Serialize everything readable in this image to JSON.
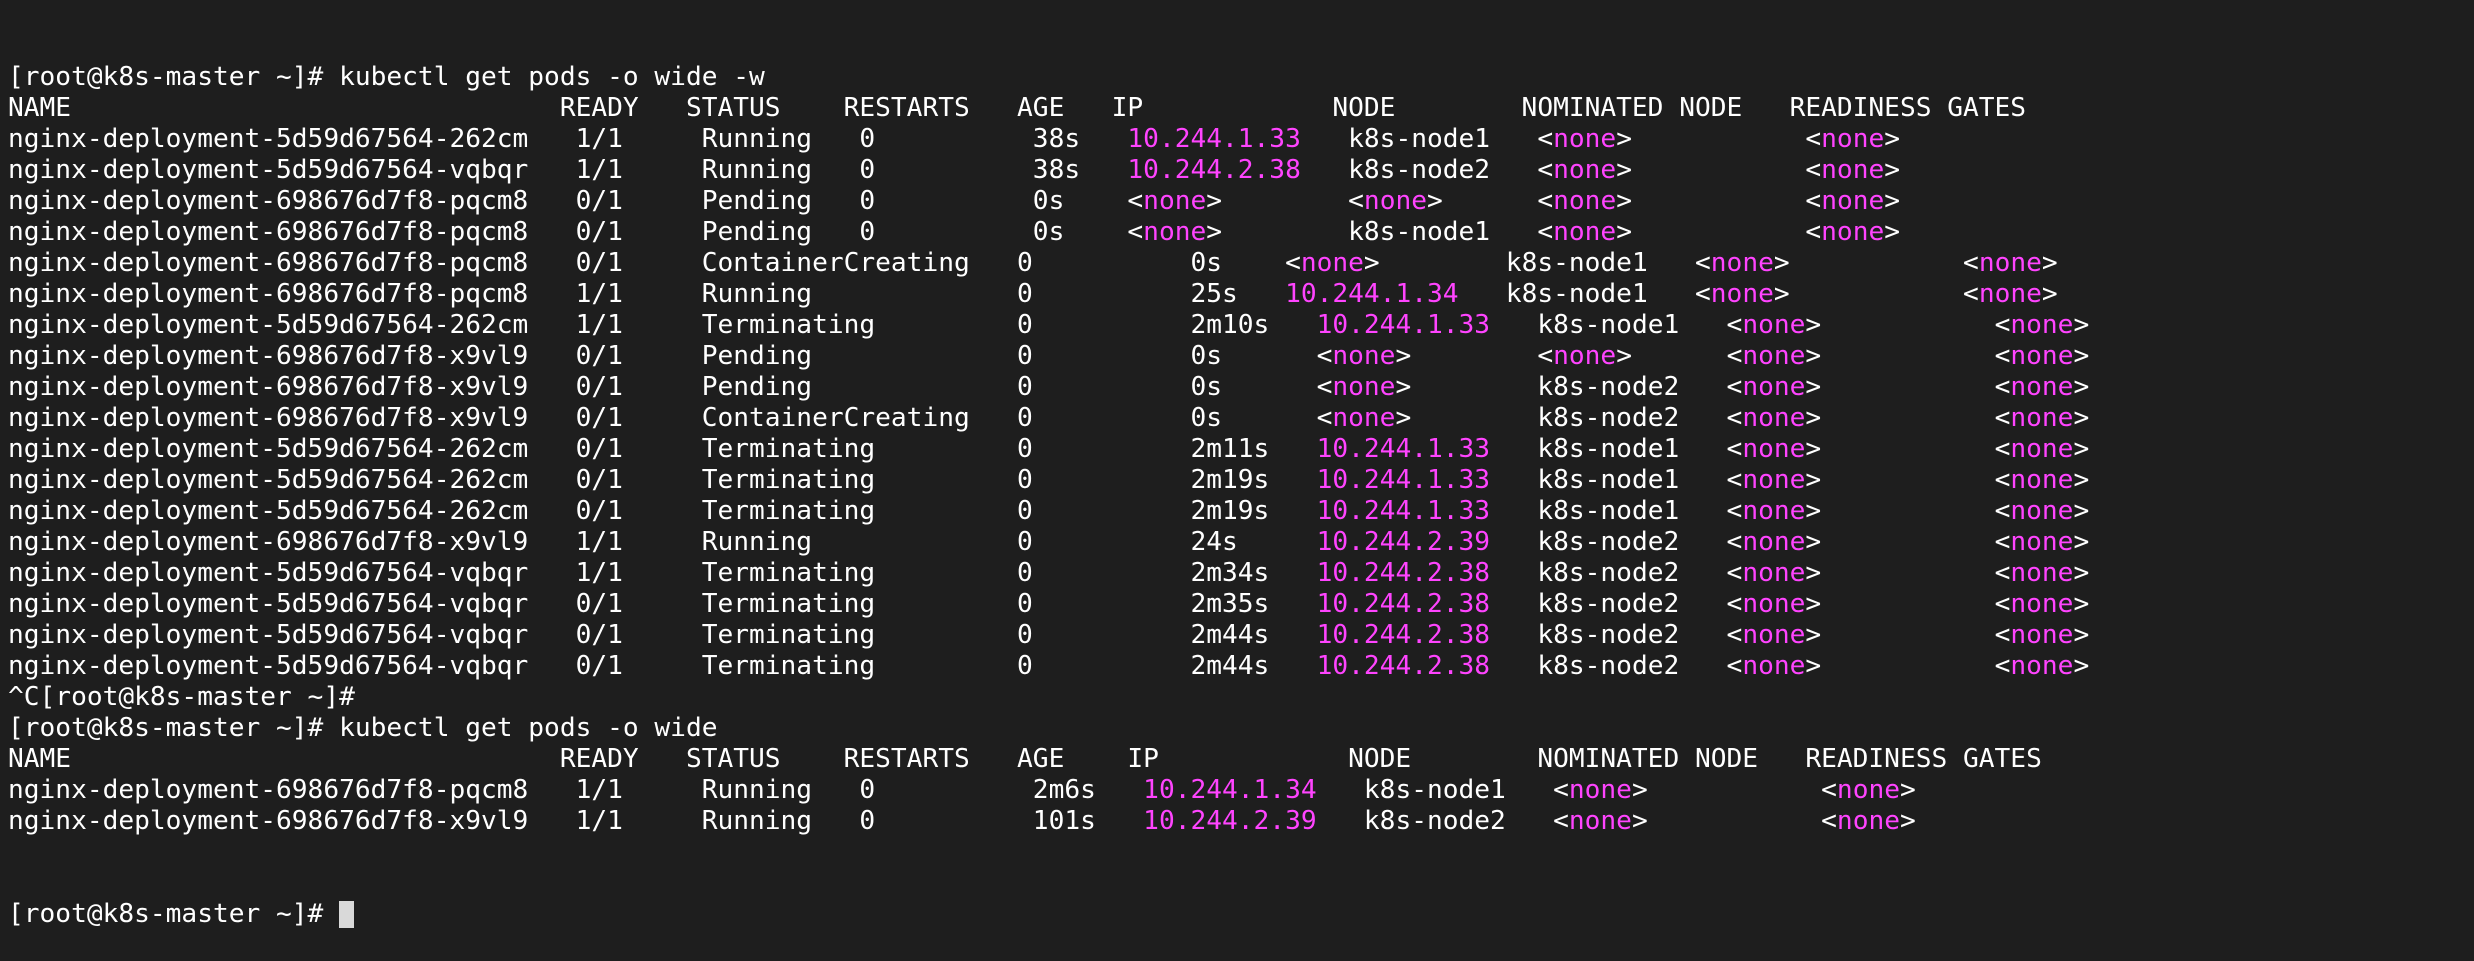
{
  "colors": {
    "background": "#1e1e1e",
    "text": "#ffffff",
    "highlight": "#ff44ff",
    "cursor": "#d9d9d9"
  },
  "terminal": {
    "lines": [
      [
        {
          "t": "[root@k8s-master ~]# kubectl get pods -o wide -w"
        }
      ],
      [
        {
          "t": "NAME                               READY   STATUS    RESTARTS   AGE   IP            NODE        NOMINATED NODE   READINESS GATES"
        }
      ],
      [
        {
          "t": "nginx-deployment-5d59d67564-262cm   1/1     Running   0          38s   "
        },
        {
          "t": "10.244.1.33",
          "m": true
        },
        {
          "t": "   k8s-node1   <"
        },
        {
          "t": "none",
          "m": true
        },
        {
          "t": ">           <"
        },
        {
          "t": "none",
          "m": true
        },
        {
          "t": ">"
        }
      ],
      [
        {
          "t": "nginx-deployment-5d59d67564-vqbqr   1/1     Running   0          38s   "
        },
        {
          "t": "10.244.2.38",
          "m": true
        },
        {
          "t": "   k8s-node2   <"
        },
        {
          "t": "none",
          "m": true
        },
        {
          "t": ">           <"
        },
        {
          "t": "none",
          "m": true
        },
        {
          "t": ">"
        }
      ],
      [
        {
          "t": "nginx-deployment-698676d7f8-pqcm8   0/1     Pending   0          0s    <"
        },
        {
          "t": "none",
          "m": true
        },
        {
          "t": ">        <"
        },
        {
          "t": "none",
          "m": true
        },
        {
          "t": ">      <"
        },
        {
          "t": "none",
          "m": true
        },
        {
          "t": ">           <"
        },
        {
          "t": "none",
          "m": true
        },
        {
          "t": ">"
        }
      ],
      [
        {
          "t": "nginx-deployment-698676d7f8-pqcm8   0/1     Pending   0          0s    <"
        },
        {
          "t": "none",
          "m": true
        },
        {
          "t": ">        k8s-node1   <"
        },
        {
          "t": "none",
          "m": true
        },
        {
          "t": ">           <"
        },
        {
          "t": "none",
          "m": true
        },
        {
          "t": ">"
        }
      ],
      [
        {
          "t": "nginx-deployment-698676d7f8-pqcm8   0/1     ContainerCreating   0          0s    <"
        },
        {
          "t": "none",
          "m": true
        },
        {
          "t": ">        k8s-node1   <"
        },
        {
          "t": "none",
          "m": true
        },
        {
          "t": ">           <"
        },
        {
          "t": "none",
          "m": true
        },
        {
          "t": ">"
        }
      ],
      [
        {
          "t": "nginx-deployment-698676d7f8-pqcm8   1/1     Running             0          25s   "
        },
        {
          "t": "10.244.1.34",
          "m": true
        },
        {
          "t": "   k8s-node1   <"
        },
        {
          "t": "none",
          "m": true
        },
        {
          "t": ">           <"
        },
        {
          "t": "none",
          "m": true
        },
        {
          "t": ">"
        }
      ],
      [
        {
          "t": "nginx-deployment-5d59d67564-262cm   1/1     Terminating         0          2m10s   "
        },
        {
          "t": "10.244.1.33",
          "m": true
        },
        {
          "t": "   k8s-node1   <"
        },
        {
          "t": "none",
          "m": true
        },
        {
          "t": ">           <"
        },
        {
          "t": "none",
          "m": true
        },
        {
          "t": ">"
        }
      ],
      [
        {
          "t": "nginx-deployment-698676d7f8-x9vl9   0/1     Pending             0          0s      <"
        },
        {
          "t": "none",
          "m": true
        },
        {
          "t": ">        <"
        },
        {
          "t": "none",
          "m": true
        },
        {
          "t": ">      <"
        },
        {
          "t": "none",
          "m": true
        },
        {
          "t": ">           <"
        },
        {
          "t": "none",
          "m": true
        },
        {
          "t": ">"
        }
      ],
      [
        {
          "t": "nginx-deployment-698676d7f8-x9vl9   0/1     Pending             0          0s      <"
        },
        {
          "t": "none",
          "m": true
        },
        {
          "t": ">        k8s-node2   <"
        },
        {
          "t": "none",
          "m": true
        },
        {
          "t": ">           <"
        },
        {
          "t": "none",
          "m": true
        },
        {
          "t": ">"
        }
      ],
      [
        {
          "t": "nginx-deployment-698676d7f8-x9vl9   0/1     ContainerCreating   0          0s      <"
        },
        {
          "t": "none",
          "m": true
        },
        {
          "t": ">        k8s-node2   <"
        },
        {
          "t": "none",
          "m": true
        },
        {
          "t": ">           <"
        },
        {
          "t": "none",
          "m": true
        },
        {
          "t": ">"
        }
      ],
      [
        {
          "t": "nginx-deployment-5d59d67564-262cm   0/1     Terminating         0          2m11s   "
        },
        {
          "t": "10.244.1.33",
          "m": true
        },
        {
          "t": "   k8s-node1   <"
        },
        {
          "t": "none",
          "m": true
        },
        {
          "t": ">           <"
        },
        {
          "t": "none",
          "m": true
        },
        {
          "t": ">"
        }
      ],
      [
        {
          "t": "nginx-deployment-5d59d67564-262cm   0/1     Terminating         0          2m19s   "
        },
        {
          "t": "10.244.1.33",
          "m": true
        },
        {
          "t": "   k8s-node1   <"
        },
        {
          "t": "none",
          "m": true
        },
        {
          "t": ">           <"
        },
        {
          "t": "none",
          "m": true
        },
        {
          "t": ">"
        }
      ],
      [
        {
          "t": "nginx-deployment-5d59d67564-262cm   0/1     Terminating         0          2m19s   "
        },
        {
          "t": "10.244.1.33",
          "m": true
        },
        {
          "t": "   k8s-node1   <"
        },
        {
          "t": "none",
          "m": true
        },
        {
          "t": ">           <"
        },
        {
          "t": "none",
          "m": true
        },
        {
          "t": ">"
        }
      ],
      [
        {
          "t": "nginx-deployment-698676d7f8-x9vl9   1/1     Running             0          24s     "
        },
        {
          "t": "10.244.2.39",
          "m": true
        },
        {
          "t": "   k8s-node2   <"
        },
        {
          "t": "none",
          "m": true
        },
        {
          "t": ">           <"
        },
        {
          "t": "none",
          "m": true
        },
        {
          "t": ">"
        }
      ],
      [
        {
          "t": "nginx-deployment-5d59d67564-vqbqr   1/1     Terminating         0          2m34s   "
        },
        {
          "t": "10.244.2.38",
          "m": true
        },
        {
          "t": "   k8s-node2   <"
        },
        {
          "t": "none",
          "m": true
        },
        {
          "t": ">           <"
        },
        {
          "t": "none",
          "m": true
        },
        {
          "t": ">"
        }
      ],
      [
        {
          "t": "nginx-deployment-5d59d67564-vqbqr   0/1     Terminating         0          2m35s   "
        },
        {
          "t": "10.244.2.38",
          "m": true
        },
        {
          "t": "   k8s-node2   <"
        },
        {
          "t": "none",
          "m": true
        },
        {
          "t": ">           <"
        },
        {
          "t": "none",
          "m": true
        },
        {
          "t": ">"
        }
      ],
      [
        {
          "t": "nginx-deployment-5d59d67564-vqbqr   0/1     Terminating         0          2m44s   "
        },
        {
          "t": "10.244.2.38",
          "m": true
        },
        {
          "t": "   k8s-node2   <"
        },
        {
          "t": "none",
          "m": true
        },
        {
          "t": ">           <"
        },
        {
          "t": "none",
          "m": true
        },
        {
          "t": ">"
        }
      ],
      [
        {
          "t": "nginx-deployment-5d59d67564-vqbqr   0/1     Terminating         0          2m44s   "
        },
        {
          "t": "10.244.2.38",
          "m": true
        },
        {
          "t": "   k8s-node2   <"
        },
        {
          "t": "none",
          "m": true
        },
        {
          "t": ">           <"
        },
        {
          "t": "none",
          "m": true
        },
        {
          "t": ">"
        }
      ],
      [
        {
          "t": "^C[root@k8s-master ~]#"
        }
      ],
      [
        {
          "t": "[root@k8s-master ~]# kubectl get pods -o wide"
        }
      ],
      [
        {
          "t": "NAME                               READY   STATUS    RESTARTS   AGE    IP            NODE        NOMINATED NODE   READINESS GATES"
        }
      ],
      [
        {
          "t": "nginx-deployment-698676d7f8-pqcm8   1/1     Running   0          2m6s   "
        },
        {
          "t": "10.244.1.34",
          "m": true
        },
        {
          "t": "   k8s-node1   <"
        },
        {
          "t": "none",
          "m": true
        },
        {
          "t": ">           <"
        },
        {
          "t": "none",
          "m": true
        },
        {
          "t": ">"
        }
      ],
      [
        {
          "t": "nginx-deployment-698676d7f8-x9vl9   1/1     Running   0          101s   "
        },
        {
          "t": "10.244.2.39",
          "m": true
        },
        {
          "t": "   k8s-node2   <"
        },
        {
          "t": "none",
          "m": true
        },
        {
          "t": ">           <"
        },
        {
          "t": "none",
          "m": true
        },
        {
          "t": ">"
        }
      ]
    ],
    "prompt": "[root@k8s-master ~]# "
  }
}
